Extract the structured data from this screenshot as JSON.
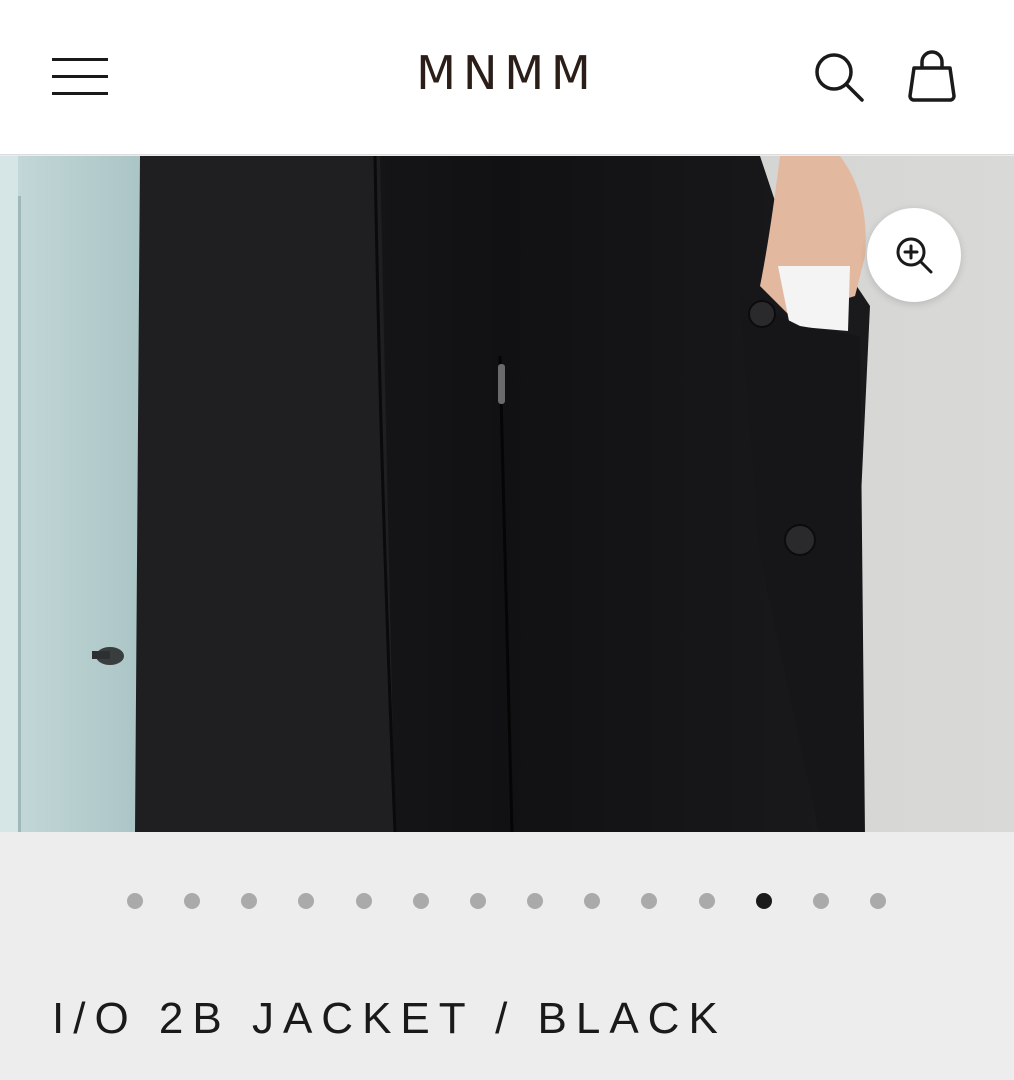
{
  "header": {
    "logo": "MNMM",
    "menu_icon": "hamburger-menu-icon",
    "search_icon": "search-icon",
    "cart_icon": "shopping-bag-icon"
  },
  "gallery": {
    "zoom_icon": "zoom-in-icon",
    "slide_count": 14,
    "active_slide": 12
  },
  "product": {
    "title": "I/O 2B JACKET / BLACK"
  },
  "colors": {
    "logo": "#2b1d18",
    "background": "#ededed",
    "dot_inactive": "#aaaaaa",
    "dot_active": "#1a1a1a"
  }
}
